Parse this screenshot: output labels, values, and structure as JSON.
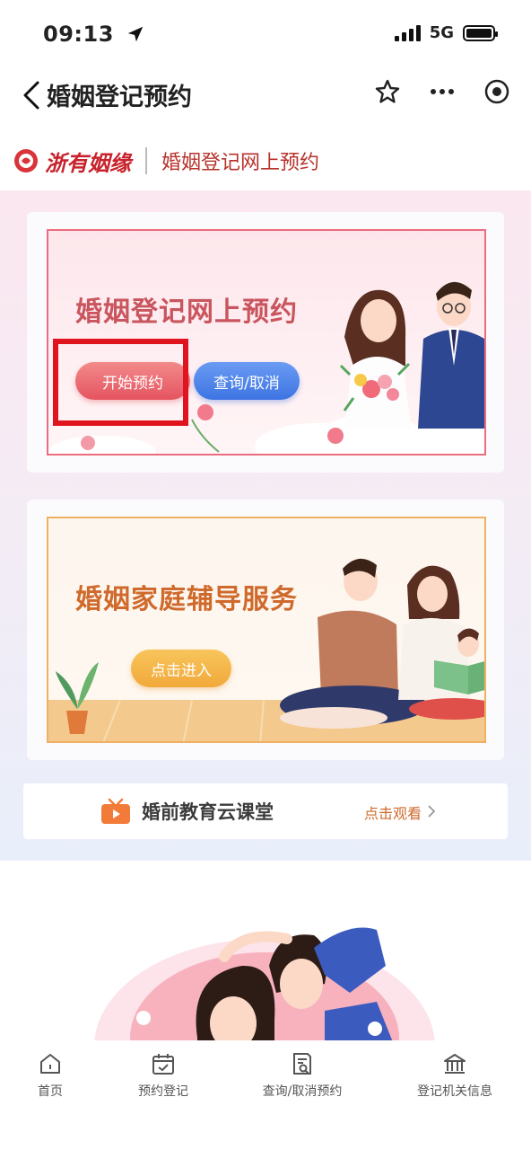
{
  "status": {
    "time": "09:13",
    "network": "5G"
  },
  "nav": {
    "title": "婚姻登记预约"
  },
  "brand": {
    "logo_text": "浙有姻缘",
    "subtitle": "婚姻登记网上预约"
  },
  "banner_registration": {
    "title": "婚姻登记网上预约",
    "start_label": "开始预约",
    "query_label": "查询/取消"
  },
  "banner_counseling": {
    "title": "婚姻家庭辅导服务",
    "enter_label": "点击进入"
  },
  "education": {
    "title": "婚前教育云课堂",
    "link_label": "点击观看"
  },
  "tabbar": {
    "items": [
      {
        "label": "首页",
        "icon": "home-icon"
      },
      {
        "label": "预约登记",
        "icon": "calendar-check-icon"
      },
      {
        "label": "查询/取消预约",
        "icon": "document-search-icon"
      },
      {
        "label": "登记机关信息",
        "icon": "building-icon"
      }
    ]
  },
  "colors": {
    "brand_red": "#c8232c",
    "start_button": "#e55461",
    "query_button": "#3d74e2",
    "enter_button": "#f1a93a",
    "highlight_box": "#e0141e"
  }
}
